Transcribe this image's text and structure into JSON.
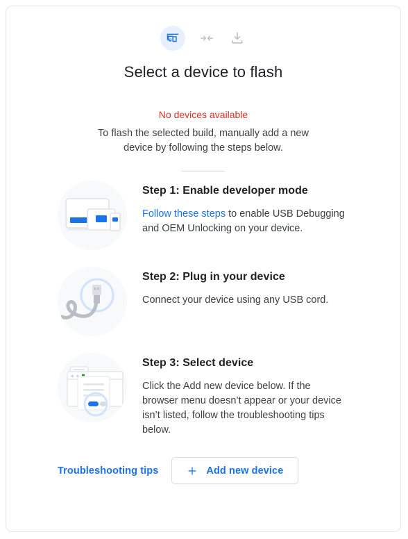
{
  "header": {
    "icons": [
      {
        "name": "devices-icon",
        "label": "devices"
      },
      {
        "name": "merge-arrows-icon",
        "label": "merge"
      },
      {
        "name": "download-icon",
        "label": "download"
      }
    ],
    "title": "Select a device to flash"
  },
  "status": {
    "error_text": "No devices available",
    "description": "To flash the selected build, manually add a new device by following the steps below."
  },
  "steps": [
    {
      "illustration": "devices-illustration",
      "title": "Step 1: Enable developer mode",
      "link_text": "Follow these steps",
      "text_after_link": " to enable USB Debugging and OEM Unlocking on your device."
    },
    {
      "illustration": "usb-cable-illustration",
      "title": "Step 2: Plug in your device",
      "text": "Connect your device using any USB cord."
    },
    {
      "illustration": "browser-document-illustration",
      "title": "Step 3: Select device",
      "text": "Click the Add new device below. If the browser menu doesn’t appear or your device isn’t listed, follow the troubleshooting tips below."
    }
  ],
  "footer": {
    "troubleshooting_label": "Troubleshooting tips",
    "add_device_label": "Add new device",
    "add_icon": "plus-icon"
  },
  "colors": {
    "accent_blue": "#1a73e8",
    "error_red": "#d93025",
    "icon_badge_bg": "#e8f0fe",
    "illustration_bg": "#f7f9fa",
    "border": "#dadce0",
    "text_primary": "#202124",
    "text_secondary": "#3c4043"
  }
}
